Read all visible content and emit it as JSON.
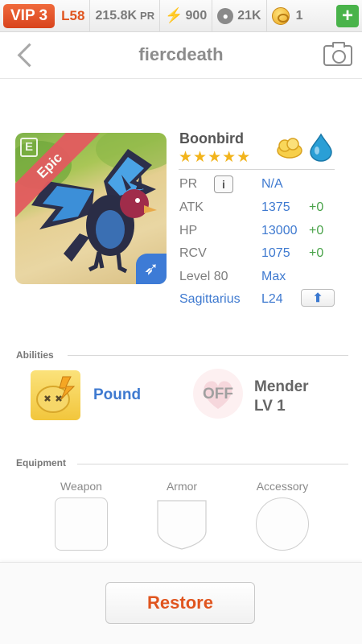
{
  "topbar": {
    "vip": "VIP 3",
    "level": "L58",
    "pr": "215.8K",
    "pr_unit": "PR",
    "energy": "900",
    "food": "21K",
    "coins": "1",
    "add_label": "+"
  },
  "header": {
    "title": "fiercdeath"
  },
  "pet": {
    "name": "Boonbird",
    "rarity": "Epic",
    "stars": "★★★★★",
    "star_count": 5,
    "elements": [
      "yellow-cloud",
      "water-drop"
    ],
    "stats": {
      "pr_label": "PR",
      "pr_value": "N/A",
      "atk_label": "ATK",
      "atk_value": "1375",
      "atk_bonus": "+0",
      "hp_label": "HP",
      "hp_value": "13000",
      "hp_bonus": "+0",
      "rcv_label": "RCV",
      "rcv_value": "1075",
      "rcv_bonus": "+0",
      "level_label": "Level 80",
      "level_value": "Max",
      "sign_label": "Sagittarius",
      "sign_value": "L24"
    }
  },
  "abilities": {
    "section_label": "Abilities",
    "active_name": "Pound",
    "passive_state": "OFF",
    "passive_name": "Mender",
    "passive_level": "LV 1"
  },
  "equipment": {
    "section_label": "Equipment",
    "weapon": "Weapon",
    "armor": "Armor",
    "accessory": "Accessory"
  },
  "footer": {
    "restore_label": "Restore"
  },
  "colors": {
    "accent_orange": "#e0551f",
    "link_blue": "#3f7ad0",
    "bonus_green": "#4aa34a",
    "star_gold": "#f2b41c",
    "epic_red": "#e35b5f"
  }
}
